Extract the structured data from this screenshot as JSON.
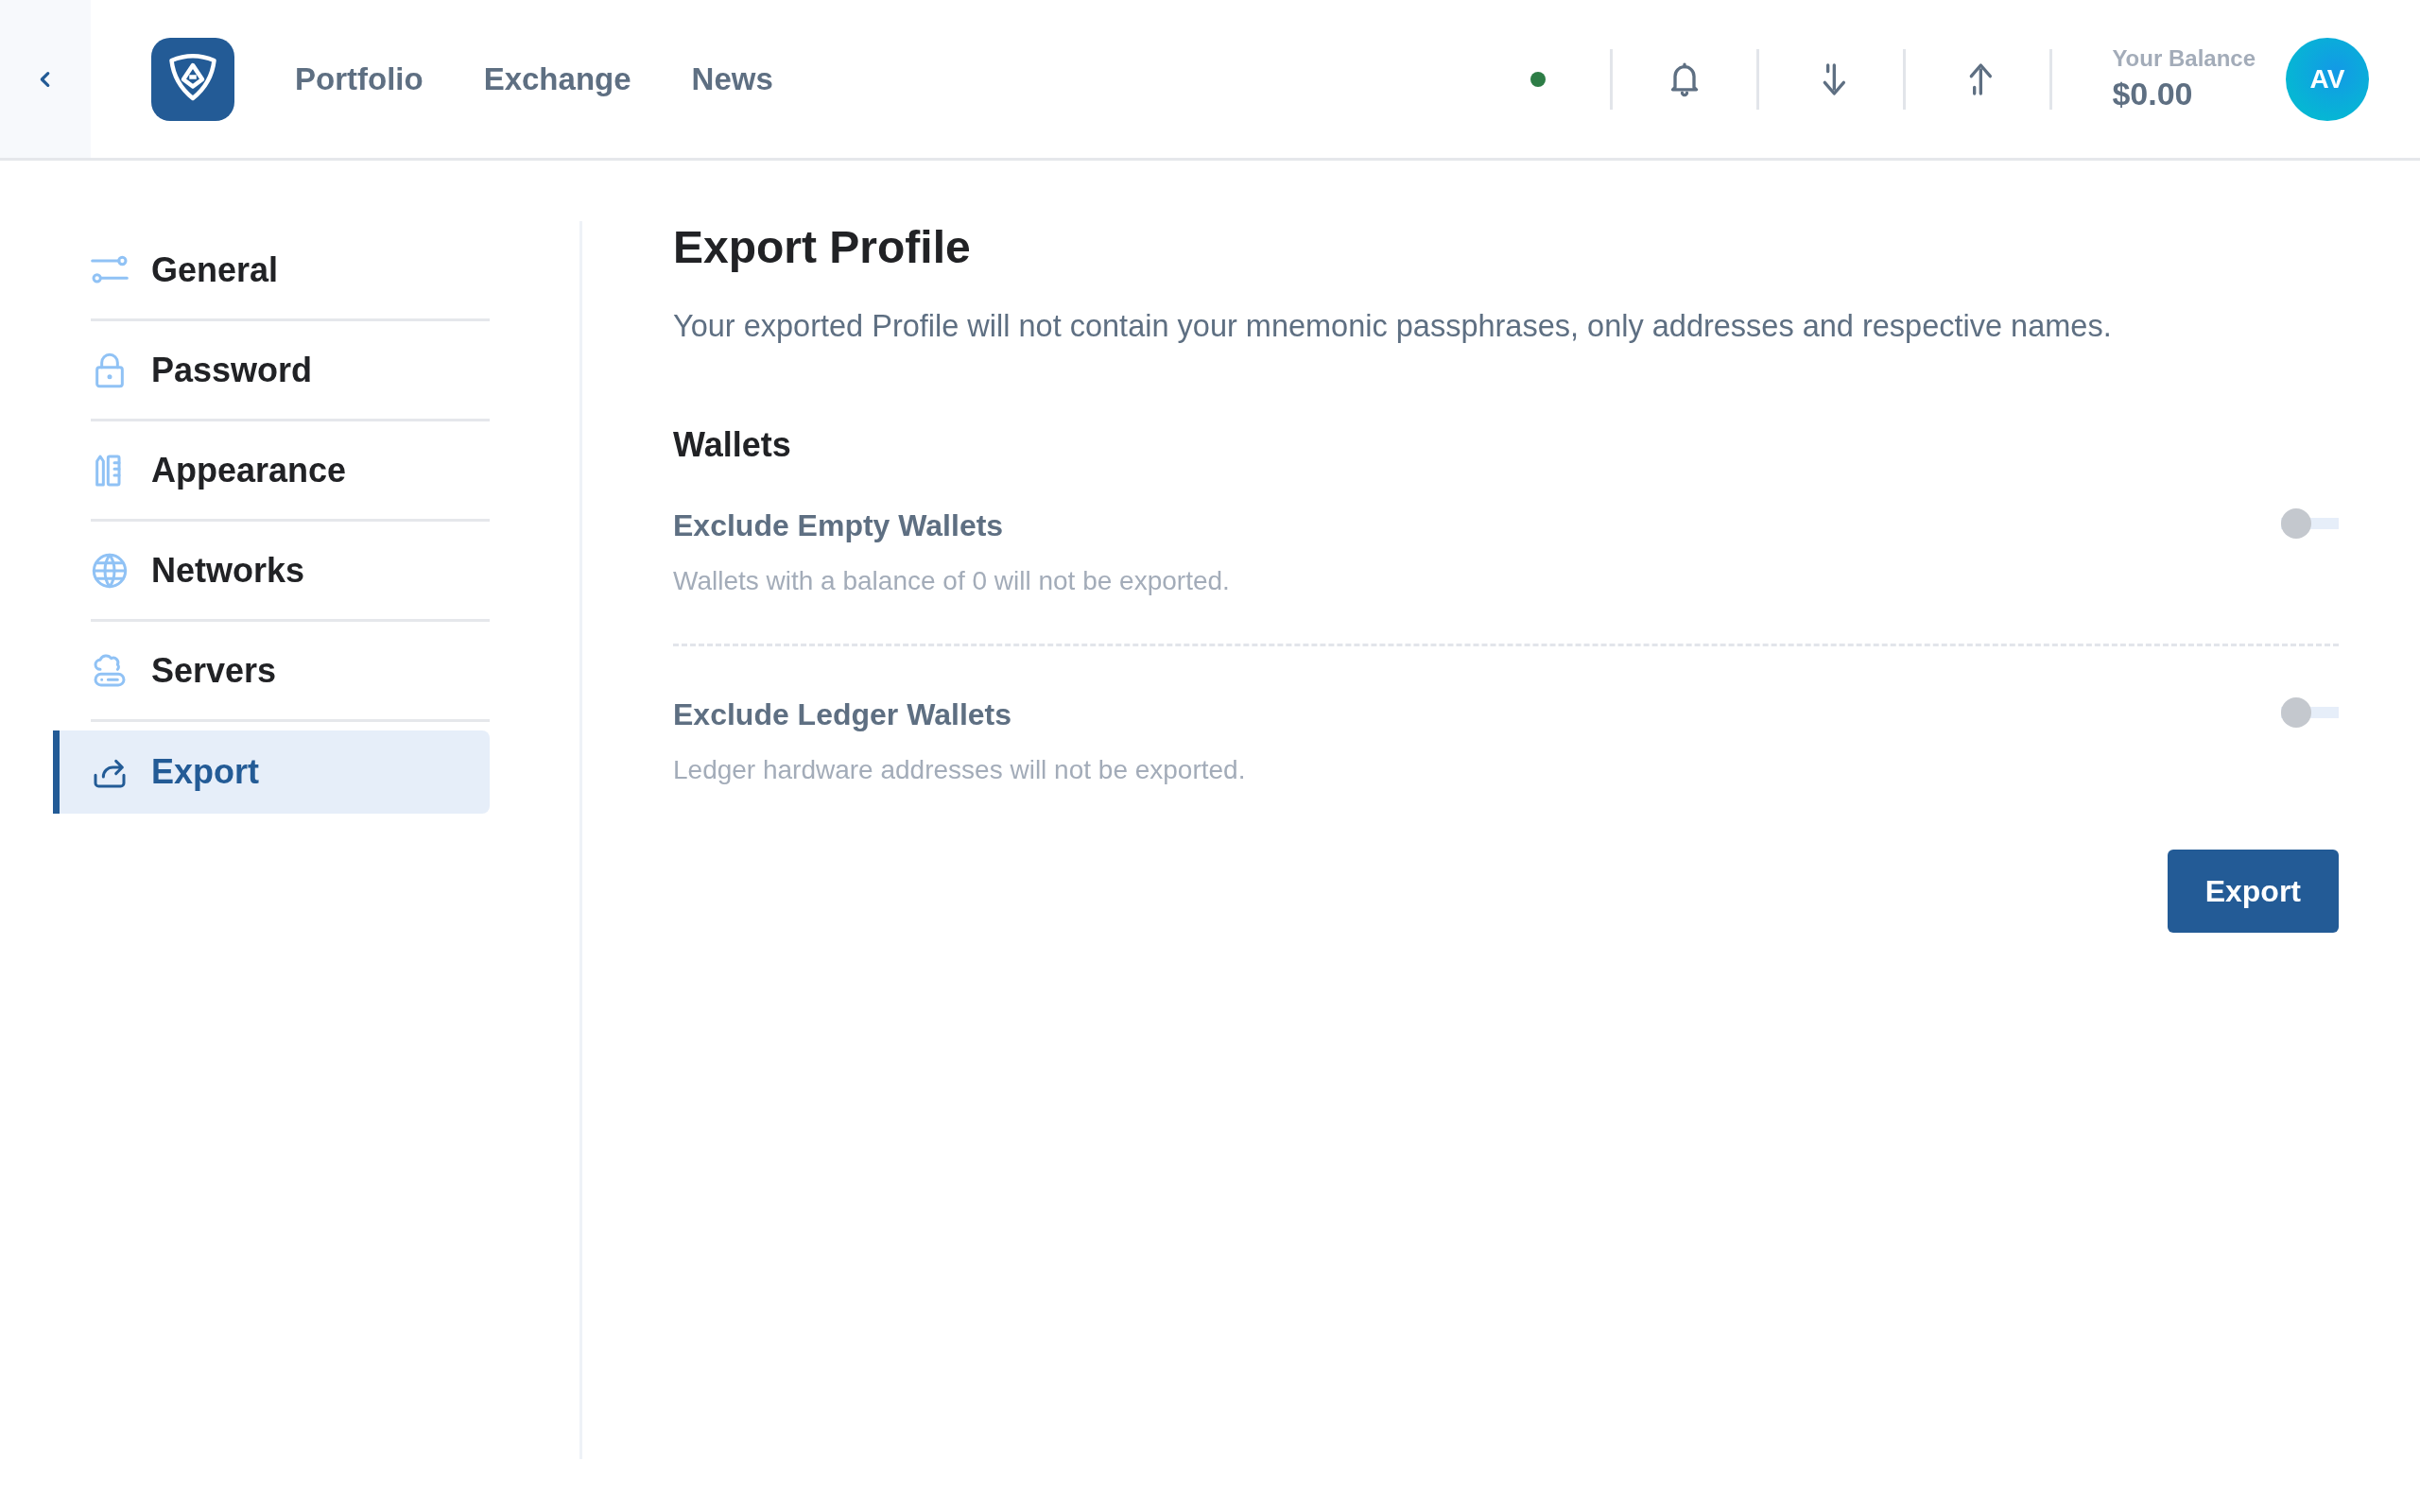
{
  "header": {
    "nav": [
      {
        "label": "Portfolio"
      },
      {
        "label": "Exchange"
      },
      {
        "label": "News"
      }
    ],
    "status": {
      "online": true
    },
    "balance": {
      "label": "Your Balance",
      "amount": "$0.00"
    },
    "avatar": {
      "initials": "AV"
    }
  },
  "sidebar": {
    "items": [
      {
        "label": "General",
        "kind": "general",
        "selected": false
      },
      {
        "label": "Password",
        "kind": "password",
        "selected": false
      },
      {
        "label": "Appearance",
        "kind": "appearance",
        "selected": false
      },
      {
        "label": "Networks",
        "kind": "networks",
        "selected": false
      },
      {
        "label": "Servers",
        "kind": "servers",
        "selected": false
      },
      {
        "label": "Export",
        "kind": "export",
        "selected": true
      }
    ]
  },
  "content": {
    "title": "Export Profile",
    "description": "Your exported Profile will not contain your mnemonic passphrases, only addresses and respective names.",
    "section": "Wallets",
    "options": [
      {
        "label": "Exclude Empty Wallets",
        "hint": "Wallets with a balance of 0 will not be exported.",
        "on": false
      },
      {
        "label": "Exclude Ledger Wallets",
        "hint": "Ledger hardware addresses will not be exported.",
        "on": false
      }
    ],
    "button": "Export"
  }
}
